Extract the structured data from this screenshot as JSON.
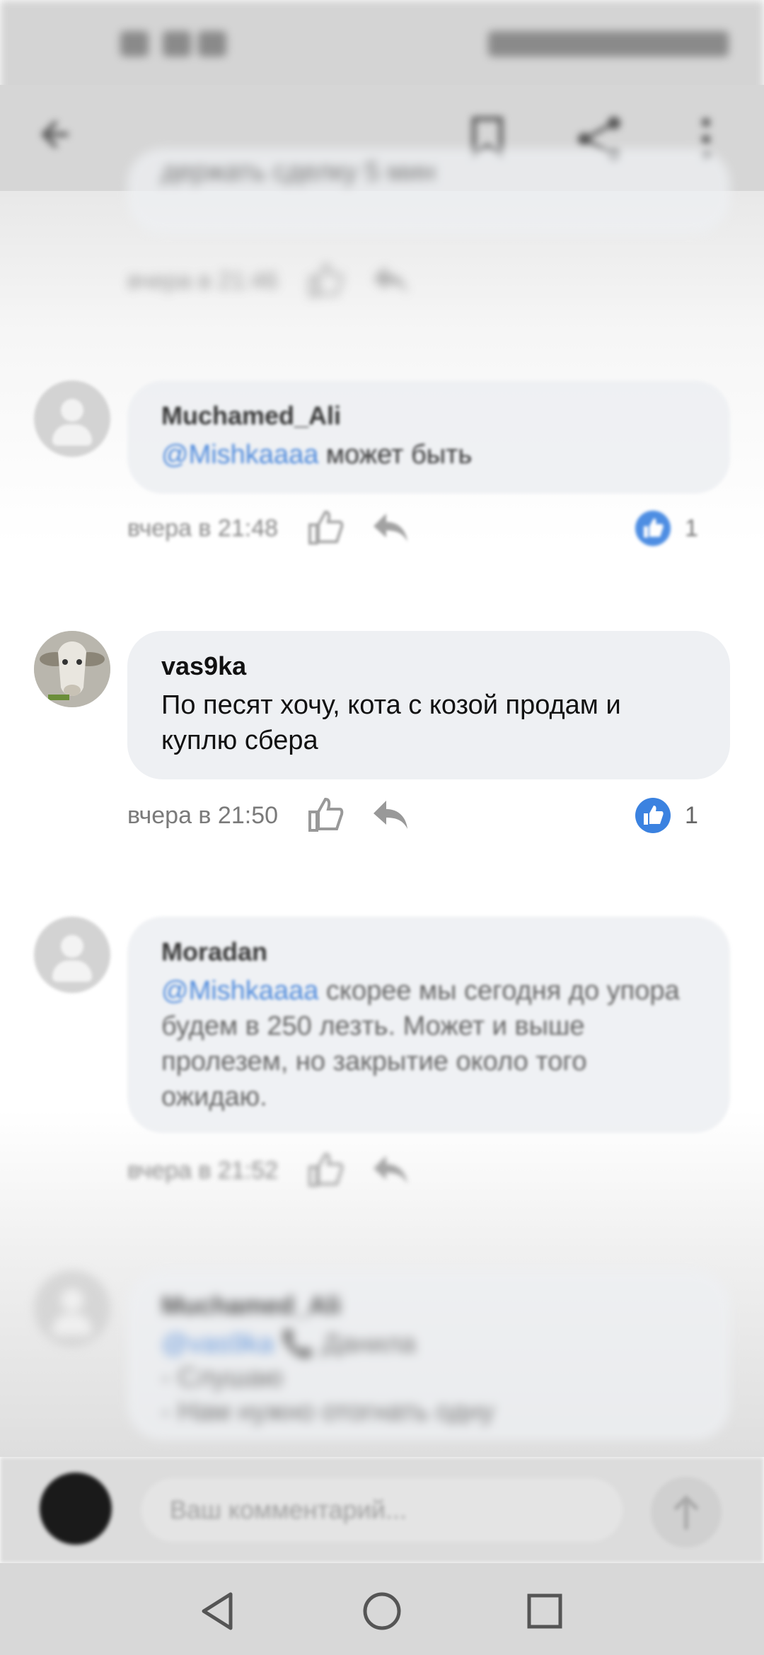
{
  "comments": [
    {
      "id": "c0",
      "author": "",
      "text": "держать сделку 5 мин",
      "time": "вчера в 21:46",
      "likes": ""
    },
    {
      "id": "c1",
      "author": "Muchamed_Ali",
      "mention": "@Mishkaaaa",
      "text": " может быть",
      "time": "вчера в 21:48",
      "likes": "1"
    },
    {
      "id": "c2",
      "author": "vas9ka",
      "text": "По песят хочу, кота с козой продам и куплю сбера",
      "time": "вчера в 21:50",
      "likes": "1"
    },
    {
      "id": "c3",
      "author": "Moradan",
      "mention": "@Mishkaaaa",
      "text": "  скорее мы сегодня до упора будем в 250 лезть. Может и выше пролезем, но закрытие около того ожидаю.",
      "time": "вчера в 21:52",
      "likes": ""
    },
    {
      "id": "c4",
      "author": "Muchamed_Ali",
      "mention": "@vas9ka",
      "text": " 📞 Данила",
      "line2": "- Слушаю",
      "line3": "- Нам нужно отогнать одну",
      "time": "",
      "likes": ""
    }
  ],
  "composer": {
    "placeholder": "Ваш комментарий..."
  },
  "colors": {
    "accent": "#3d7fd9",
    "like_badge": "#3b82e0",
    "bubble": "#eef0f3"
  },
  "icons": [
    "back-icon",
    "bookmark-icon",
    "share-icon",
    "more-icon",
    "like-icon",
    "reply-icon",
    "send-icon",
    "nav-back-icon",
    "nav-home-icon",
    "nav-recents-icon"
  ]
}
